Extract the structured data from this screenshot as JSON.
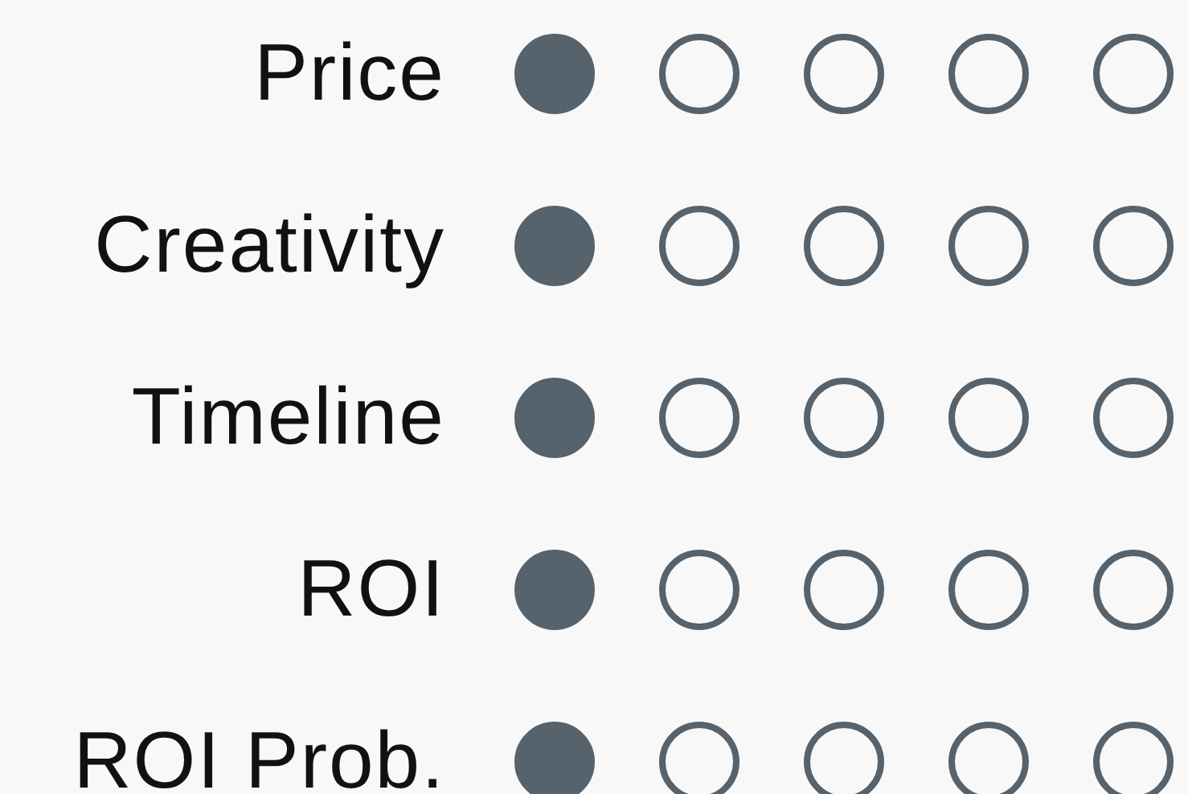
{
  "ratings": [
    {
      "label": "Price",
      "stars": 1
    },
    {
      "label": "Creativity",
      "stars": 1
    },
    {
      "label": "Timeline",
      "stars": 1
    },
    {
      "label": "ROI",
      "stars": 1
    },
    {
      "label": "ROI Prob.",
      "stars": 1
    }
  ]
}
